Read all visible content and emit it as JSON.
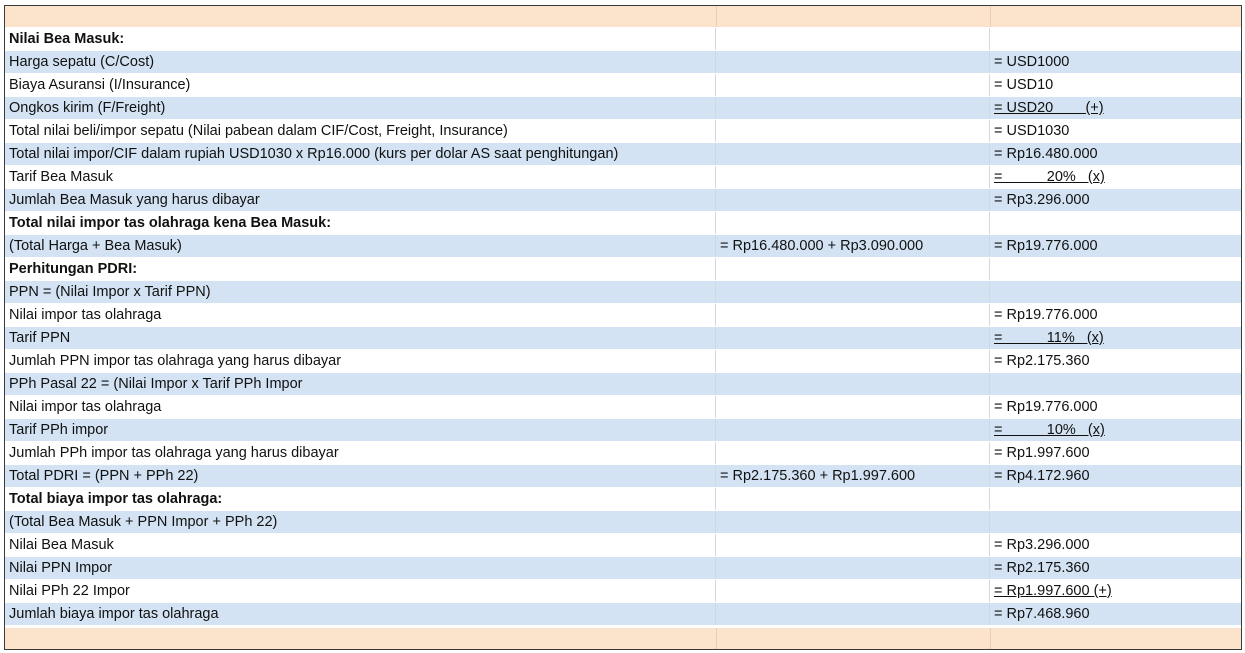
{
  "rows": [
    {
      "a": "Nilai Bea Masuk:",
      "b": "",
      "c": "",
      "bold": true,
      "ul": false
    },
    {
      "a": "Harga sepatu (C/Cost)",
      "b": "",
      "c": "= USD1000",
      "bold": false,
      "ul": false
    },
    {
      "a": "Biaya Asuransi (I/Insurance)",
      "b": "",
      "c": "= USD10",
      "bold": false,
      "ul": false
    },
    {
      "a": "Ongkos kirim (F/Freight)",
      "b": "",
      "c": "= USD20        (+)",
      "bold": false,
      "ul": true
    },
    {
      "a": "Total nilai beli/impor sepatu (Nilai pabean dalam CIF/Cost, Freight, Insurance)",
      "b": "",
      "c": "= USD1030",
      "bold": false,
      "ul": false
    },
    {
      "a": "Total nilai impor/CIF dalam rupiah USD1030 x Rp16.000 (kurs per dolar AS saat penghitungan)",
      "b": "",
      "c": "= Rp16.480.000",
      "bold": false,
      "ul": false
    },
    {
      "a": "Tarif Bea Masuk",
      "b": "",
      "c": "=           20%   (x)",
      "bold": false,
      "ul": true
    },
    {
      "a": "Jumlah Bea Masuk yang harus dibayar",
      "b": "",
      "c": "= Rp3.296.000",
      "bold": false,
      "ul": false
    },
    {
      "a": "Total nilai impor tas olahraga kena Bea Masuk:",
      "b": "",
      "c": "",
      "bold": true,
      "ul": false
    },
    {
      "a": "(Total Harga + Bea Masuk)",
      "b": "= Rp16.480.000 + Rp3.090.000",
      "c": "= Rp19.776.000",
      "bold": false,
      "ul": false
    },
    {
      "a": "Perhitungan PDRI:",
      "b": "",
      "c": "",
      "bold": true,
      "ul": false
    },
    {
      "a": "PPN = (Nilai Impor x Tarif PPN)",
      "b": "",
      "c": "",
      "bold": false,
      "ul": false
    },
    {
      "a": "Nilai impor tas olahraga",
      "b": "",
      "c": "= Rp19.776.000",
      "bold": false,
      "ul": false
    },
    {
      "a": "Tarif PPN",
      "b": "",
      "c": "=           11%   (x)",
      "bold": false,
      "ul": true
    },
    {
      "a": "Jumlah PPN impor tas olahraga yang harus dibayar",
      "b": "",
      "c": "= Rp2.175.360",
      "bold": false,
      "ul": false
    },
    {
      "a": "PPh Pasal 22 = (Nilai Impor x Tarif PPh Impor",
      "b": "",
      "c": "",
      "bold": false,
      "ul": false
    },
    {
      "a": "Nilai impor tas olahraga",
      "b": "",
      "c": "= Rp19.776.000",
      "bold": false,
      "ul": false
    },
    {
      "a": "Tarif PPh impor",
      "b": "",
      "c": "=           10%   (x)",
      "bold": false,
      "ul": true
    },
    {
      "a": "Jumlah PPh impor tas olahraga yang harus dibayar",
      "b": "",
      "c": "= Rp1.997.600",
      "bold": false,
      "ul": false
    },
    {
      "a": "Total PDRI = (PPN + PPh 22)",
      "b": "= Rp2.175.360 + Rp1.997.600",
      "c": "= Rp4.172.960",
      "bold": false,
      "ul": false
    },
    {
      "a": "Total biaya impor tas olahraga:",
      "b": "",
      "c": "",
      "bold": true,
      "ul": false
    },
    {
      "a": "(Total Bea Masuk + PPN Impor + PPh 22)",
      "b": "",
      "c": "",
      "bold": false,
      "ul": false
    },
    {
      "a": "Nilai Bea Masuk",
      "b": "",
      "c": "= Rp3.296.000",
      "bold": false,
      "ul": false
    },
    {
      "a": "Nilai PPN Impor",
      "b": "",
      "c": "= Rp2.175.360",
      "bold": false,
      "ul": false
    },
    {
      "a": "Nilai PPh 22 Impor",
      "b": "",
      "c": "= Rp1.997.600 (+)",
      "bold": false,
      "ul": true
    },
    {
      "a": "Jumlah biaya impor tas olahraga",
      "b": "",
      "c": "= Rp7.468.960",
      "bold": false,
      "ul": false
    }
  ],
  "colors": {
    "row_blue": "#d3e3f3",
    "row_white": "#ffffff",
    "band_peach": "#fbe3cc",
    "text": "#111111"
  }
}
